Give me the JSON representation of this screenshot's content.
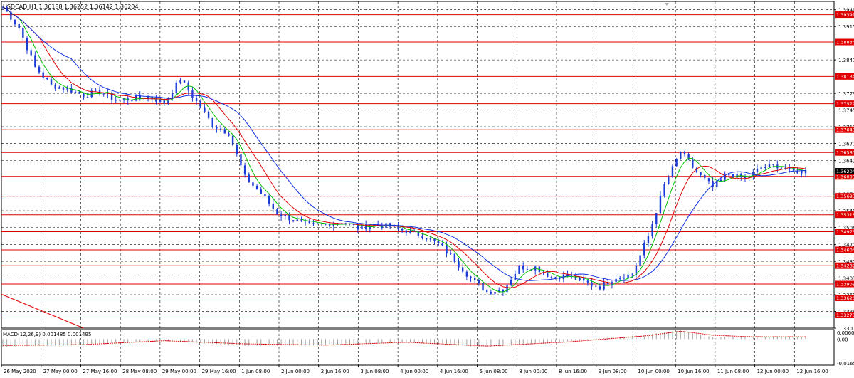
{
  "window": {
    "title": "USDCAD,H1  1.36188 1.36252 1.36142 1.36204"
  },
  "colors": {
    "background": "#ffffff",
    "grid": "#000000",
    "price_bars": "#1a3bd6",
    "ma_fast": "#00c000",
    "ma_mid": "#e00000",
    "ma_slow": "#1030e0",
    "level_lines": "#e00000",
    "level_label_bg": "#e00000",
    "level_label_text": "#ffffff",
    "current_price_bg": "#000000",
    "macd_hist": "#a0a0a0",
    "macd_signal": "#e00000"
  },
  "chart_data": [
    {
      "type": "line",
      "title": "USDCAD,H1  1.36188 1.36252 1.36142 1.36204",
      "grid": true,
      "x_tick_labels": [
        "26 May 2020",
        "27 May 00:00",
        "27 May 16:00",
        "28 May 08:00",
        "29 May 00:00",
        "29 May 16:00",
        "1 Jun 08:00",
        "2 Jun 00:00",
        "2 Jun 16:00",
        "3 Jun 08:00",
        "4 Jun 00:00",
        "4 Jun 16:00",
        "5 Jun 08:00",
        "8 Jun 00:00",
        "8 Jun 16:00",
        "9 Jun 08:00",
        "10 Jun 00:00",
        "10 Jun 16:00",
        "11 Jun 08:00",
        "12 Jun 00:00",
        "12 Jun 16:00"
      ],
      "y_tick_labels": [
        "1.39490",
        "1.39150",
        "1.38470",
        "1.37790",
        "1.37450",
        "1.37110",
        "1.36770",
        "1.36420",
        "1.35740",
        "1.35400",
        "1.35060",
        "1.34710",
        "1.34370",
        "1.34030",
        "1.33690",
        "1.33350",
        "1.33010"
      ],
      "ylim": [
        1.3301,
        1.3966
      ],
      "current_price": "1.36204",
      "levels": [
        "1.39391",
        "1.38834",
        "1.38134",
        "1.37579",
        "1.37049",
        "1.36585",
        "1.36099",
        "1.35695",
        "1.35318",
        "1.34973",
        "1.34604",
        "1.34282",
        "1.33908",
        "1.33626",
        "1.33278"
      ],
      "close_series": {
        "x": [
          0,
          4,
          8,
          12,
          16,
          20,
          24,
          28,
          32,
          36,
          40,
          44,
          48,
          52,
          56,
          60,
          64,
          68,
          72,
          76,
          80,
          84,
          88,
          92,
          96,
          100,
          104,
          108,
          112,
          116,
          120,
          124,
          128,
          132,
          136,
          140,
          144,
          148,
          152,
          156,
          160,
          164,
          168,
          172,
          176,
          180,
          184,
          188,
          192,
          196,
          199
        ],
        "values": [
          1.3955,
          1.3912,
          1.3832,
          1.3795,
          1.3788,
          1.3775,
          1.3783,
          1.3765,
          1.3768,
          1.3772,
          1.376,
          1.3808,
          1.3762,
          1.3715,
          1.3698,
          1.3608,
          1.3575,
          1.3535,
          1.3522,
          1.351,
          1.3512,
          1.3518,
          1.3505,
          1.3512,
          1.3508,
          1.3498,
          1.349,
          1.3472,
          1.344,
          1.3402,
          1.3375,
          1.338,
          1.3425,
          1.3425,
          1.3405,
          1.3408,
          1.3395,
          1.3385,
          1.3405,
          1.341,
          1.3488,
          1.3592,
          1.366,
          1.3618,
          1.3588,
          1.3615,
          1.3605,
          1.3628,
          1.3632,
          1.362,
          1.36204
        ]
      },
      "moving_averages": [
        "green",
        "red",
        "blue"
      ],
      "trendline": {
        "from_price": 1.337,
        "to_price": 1.3301
      }
    },
    {
      "type": "bar",
      "title": "MACD(12,26,9) 0.001485 0.001495",
      "y_tick_labels": [
        "0.006065",
        "0.00",
        "-0.016558"
      ],
      "ylim": [
        -0.016558,
        0.006065
      ],
      "histogram": {
        "x": [
          0,
          20,
          40,
          60,
          80,
          100,
          120,
          140,
          160,
          168,
          176,
          184,
          188
        ],
        "values": [
          -0.0048,
          -0.0038,
          -0.0012,
          -0.0042,
          -0.004,
          -0.0018,
          -0.0052,
          -0.0014,
          0.003,
          0.0056,
          0.0012,
          0.0018,
          0.0016
        ]
      },
      "signal_line": {
        "x": [
          0,
          20,
          40,
          60,
          80,
          100,
          120,
          140,
          160,
          168,
          176,
          184,
          188
        ],
        "values": [
          -0.004,
          -0.0035,
          -0.001,
          -0.003,
          -0.0038,
          -0.002,
          -0.0044,
          -0.0018,
          0.0022,
          0.005,
          0.0025,
          0.0016,
          0.0015
        ]
      }
    }
  ]
}
